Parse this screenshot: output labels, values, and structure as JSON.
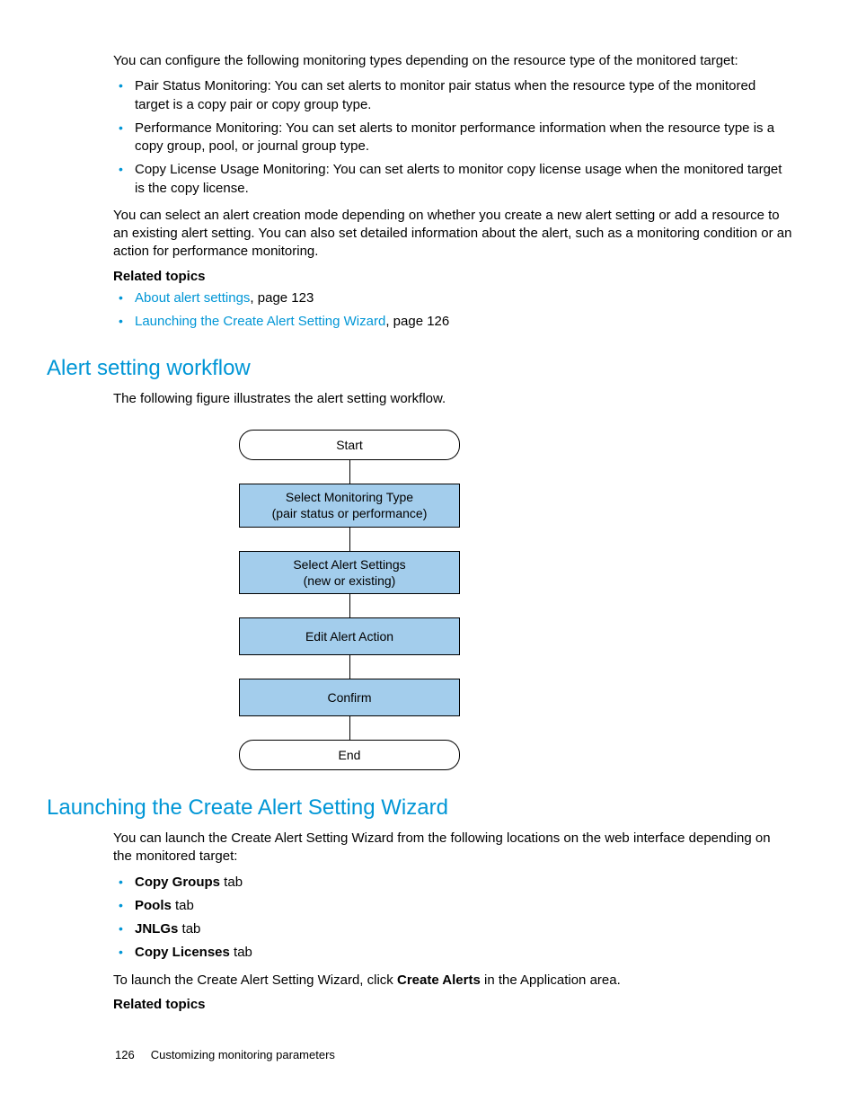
{
  "intro": {
    "para1": "You can configure the following monitoring types depending on the resource type of the monitored target:",
    "bullets": [
      "Pair Status Monitoring: You can set alerts to monitor pair status when the resource type of the monitored target is a copy pair or copy group type.",
      "Performance Monitoring: You can set alerts to monitor performance information when the resource type is a copy group, pool, or journal group type.",
      "Copy License Usage Monitoring: You can set alerts to monitor copy license usage when the monitored target is the copy license."
    ],
    "para2": "You can select an alert creation mode depending on whether you create a new alert setting or add a resource to an existing alert setting. You can also set detailed information about the alert, such as a monitoring condition or an action for performance monitoring.",
    "related_label": "Related topics",
    "related": [
      {
        "link": "About alert settings",
        "rest": ", page 123"
      },
      {
        "link": "Launching the Create Alert Setting Wizard",
        "rest": ", page 126"
      }
    ]
  },
  "workflow": {
    "heading": "Alert setting workflow",
    "para": "The following figure illustrates the alert setting workflow.",
    "flow": {
      "start": "Start",
      "step1": "Select Monitoring Type\n(pair status or performance)",
      "step2": "Select Alert Settings\n(new or existing)",
      "step3": "Edit Alert Action",
      "step4": "Confirm",
      "end": "End"
    }
  },
  "launching": {
    "heading": "Launching the Create Alert Setting Wizard",
    "para1": "You can launch the Create Alert Setting Wizard from the following locations on the web interface depending on the monitored target:",
    "tabs": [
      {
        "bold": "Copy Groups",
        "rest": " tab"
      },
      {
        "bold": "Pools",
        "rest": " tab"
      },
      {
        "bold": "JNLGs",
        "rest": " tab"
      },
      {
        "bold": "Copy Licenses",
        "rest": " tab"
      }
    ],
    "para2_a": "To launch the Create Alert Setting Wizard, click ",
    "para2_bold": "Create Alerts",
    "para2_b": " in the Application area.",
    "related_label": "Related topics"
  },
  "footer": {
    "page": "126",
    "title": "Customizing monitoring parameters"
  }
}
